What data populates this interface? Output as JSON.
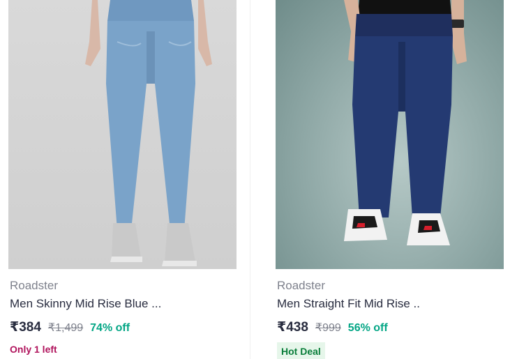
{
  "products": [
    {
      "brand": "Roadster",
      "title": "Men Skinny Mid Rise Blue ...",
      "price": "₹384",
      "mrp": "₹1,499",
      "discount": "74% off",
      "tag": "Only 1 left",
      "image_alt": "Light blue skinny jeans"
    },
    {
      "brand": "Roadster",
      "title": "Men Straight Fit Mid Rise ..",
      "price": "₹438",
      "mrp": "₹999",
      "discount": "56% off",
      "tag": "Hot Deal",
      "image_alt": "Dark blue straight fit jeans"
    }
  ],
  "colors": {
    "brand_text": "#7e818c",
    "title_text": "#282c3f",
    "discount_green": "#03a685",
    "urgency_pink": "#b0135c",
    "deal_green": "#0a7e3a",
    "deal_bg": "#e6f6ea"
  }
}
